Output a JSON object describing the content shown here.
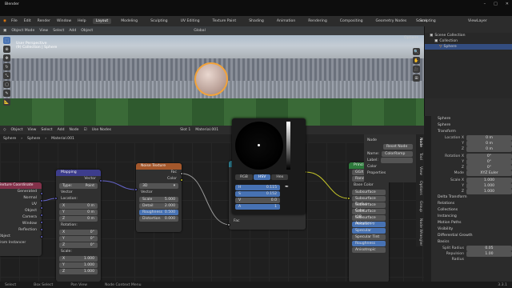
{
  "app": {
    "title": "Blender"
  },
  "menu": [
    "File",
    "Edit",
    "Render",
    "Window",
    "Help"
  ],
  "workspaces": [
    "Layout",
    "Modeling",
    "Sculpting",
    "UV Editing",
    "Texture Paint",
    "Shading",
    "Animation",
    "Rendering",
    "Compositing",
    "Geometry Nodes",
    "Scripting"
  ],
  "top_right": {
    "scene": "Scene",
    "view_layer": "ViewLayer"
  },
  "viewport": {
    "mode": "Object Mode",
    "menus": [
      "View",
      "Select",
      "Add",
      "Object"
    ],
    "transform": "Global",
    "overlay1": "User Perspective",
    "overlay2": "(9) Collection | Sphere",
    "options": "Options"
  },
  "outliner": {
    "root": "Scene Collection",
    "collection": "Collection",
    "object": "Sphere"
  },
  "node_editor": {
    "mode": "Object",
    "menus": [
      "View",
      "Select",
      "Add",
      "Node"
    ],
    "use_nodes": "Use Nodes",
    "slot": "Slot 1",
    "material": "Material.001",
    "breadcrumb": [
      "Sphere",
      "Sphere",
      "Material.001"
    ]
  },
  "nodes": {
    "texcoord": {
      "title": "Texture Coordinate",
      "outputs": [
        "Generated",
        "Normal",
        "UV",
        "Object",
        "Camera",
        "Window",
        "Reflection"
      ],
      "object_label": "Object",
      "from_instancer": "From Instancer"
    },
    "mapping": {
      "title": "Mapping",
      "output": "Vector",
      "type_label": "Type:",
      "type_value": "Point",
      "input": "Vector",
      "location_label": "Location:",
      "location": [
        [
          "X",
          "0 m"
        ],
        [
          "Y",
          "0 m"
        ],
        [
          "Z",
          "0 m"
        ]
      ],
      "rotation_label": "Rotation:",
      "rotation": [
        [
          "X",
          "0°"
        ],
        [
          "Y",
          "0°"
        ],
        [
          "Z",
          "0°"
        ]
      ],
      "scale_label": "Scale:",
      "scale": [
        [
          "X",
          "1.000"
        ],
        [
          "Y",
          "1.000"
        ],
        [
          "Z",
          "1.000"
        ]
      ]
    },
    "noise": {
      "title": "Noise Texture",
      "outputs": [
        "Fac",
        "Color"
      ],
      "dim": "3D",
      "input": "Vector",
      "fields": [
        [
          "Scale",
          "5.000"
        ],
        [
          "Detail",
          "2.000"
        ],
        [
          "Roughness",
          "0.500"
        ],
        [
          "Distortion",
          "0.000"
        ]
      ]
    },
    "colorramp": {
      "outputs": [
        "Color",
        "Alpha"
      ],
      "input": "Fac"
    },
    "bsdf": {
      "title": "Principled BSDF",
      "rows": [
        "GGX",
        "Random Walk",
        "Base Color",
        "Subsurface",
        "Subsurface Radius",
        "Subsurface Color",
        "Subsurface IOR",
        "Subsurface Anisotropy",
        "Metallic",
        "Specular",
        "Specular Tint",
        "Roughness",
        "Anisotropic"
      ]
    }
  },
  "picker": {
    "tabs": [
      "RGB",
      "HSV",
      "Hex"
    ],
    "rows": [
      [
        "H",
        "0.115"
      ],
      [
        "S",
        "0.152"
      ],
      [
        "V",
        "0.0"
      ],
      [
        "A",
        "1"
      ]
    ]
  },
  "npanel": {
    "header": "Node",
    "name_label": "Name:",
    "name": "ColorRamp",
    "label_label": "Label:",
    "reset": "Reset Node",
    "color": "Color",
    "properties": "Properties"
  },
  "ntabs": [
    "Node",
    "Tool",
    "View",
    "Options",
    "Group",
    "Node Wrangler"
  ],
  "properties": {
    "object": "Sphere",
    "mesh": "Sphere",
    "transform": "Transform",
    "location_label": "Location X",
    "loc": [
      "0 m",
      "0 m",
      "0 m"
    ],
    "rotation_label": "Rotation X",
    "rot": [
      "0°",
      "0°",
      "0°"
    ],
    "mode_label": "Mode",
    "mode": "XYZ Euler",
    "scale_label": "Scale X",
    "scale": [
      "1.000",
      "1.000",
      "1.000"
    ],
    "sections": [
      "Delta Transform",
      "Relations",
      "Collections",
      "Instancing",
      "Motion Paths",
      "Visibility",
      "Viewport Display",
      "Line Art",
      "Custom Properties"
    ],
    "physics": "Differential Growth",
    "basics": "Basics",
    "split_radius": [
      "Split Radius",
      "0.05"
    ],
    "repulsion": [
      "Repulsion Radius",
      "1.00"
    ],
    "fields": [
      "Split Radius"
    ]
  },
  "status": [
    "Select",
    "Box Select",
    "Pan View",
    "Node Context Menu"
  ],
  "version": "3.3.1"
}
